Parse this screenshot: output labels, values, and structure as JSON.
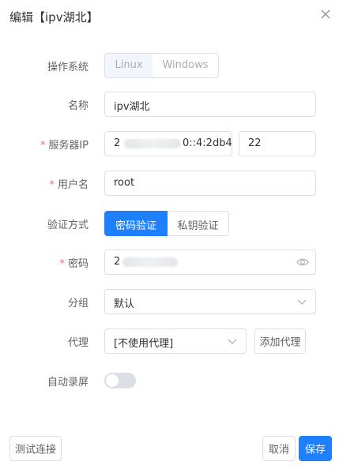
{
  "dialog": {
    "title": "编辑【ipv湖北】"
  },
  "form": {
    "os": {
      "label": "操作系统",
      "options": [
        "Linux",
        "Windows"
      ],
      "selected": "Linux"
    },
    "name": {
      "label": "名称",
      "value": "ipv湖北"
    },
    "server_ip": {
      "label": "服务器IP",
      "required": true,
      "value_visible_start": "2",
      "value_visible_end": "0::4:2db4",
      "port": "22"
    },
    "username": {
      "label": "用户名",
      "required": true,
      "value": "root"
    },
    "auth_method": {
      "label": "验证方式",
      "options": [
        "密码验证",
        "私钥验证"
      ],
      "selected": "密码验证"
    },
    "password": {
      "label": "密码",
      "required": true,
      "value_visible_start": "2"
    },
    "group": {
      "label": "分组",
      "value": "默认"
    },
    "proxy": {
      "label": "代理",
      "value": "[不使用代理]",
      "add_button": "添加代理"
    },
    "auto_record": {
      "label": "自动录屏",
      "enabled": false
    }
  },
  "footer": {
    "test_button": "测试连接",
    "cancel_button": "取消",
    "save_button": "保存"
  },
  "colors": {
    "primary": "#1e80ff",
    "required": "#f56c6c",
    "border": "#dcdfe6",
    "label": "#606266",
    "text": "#303133"
  }
}
